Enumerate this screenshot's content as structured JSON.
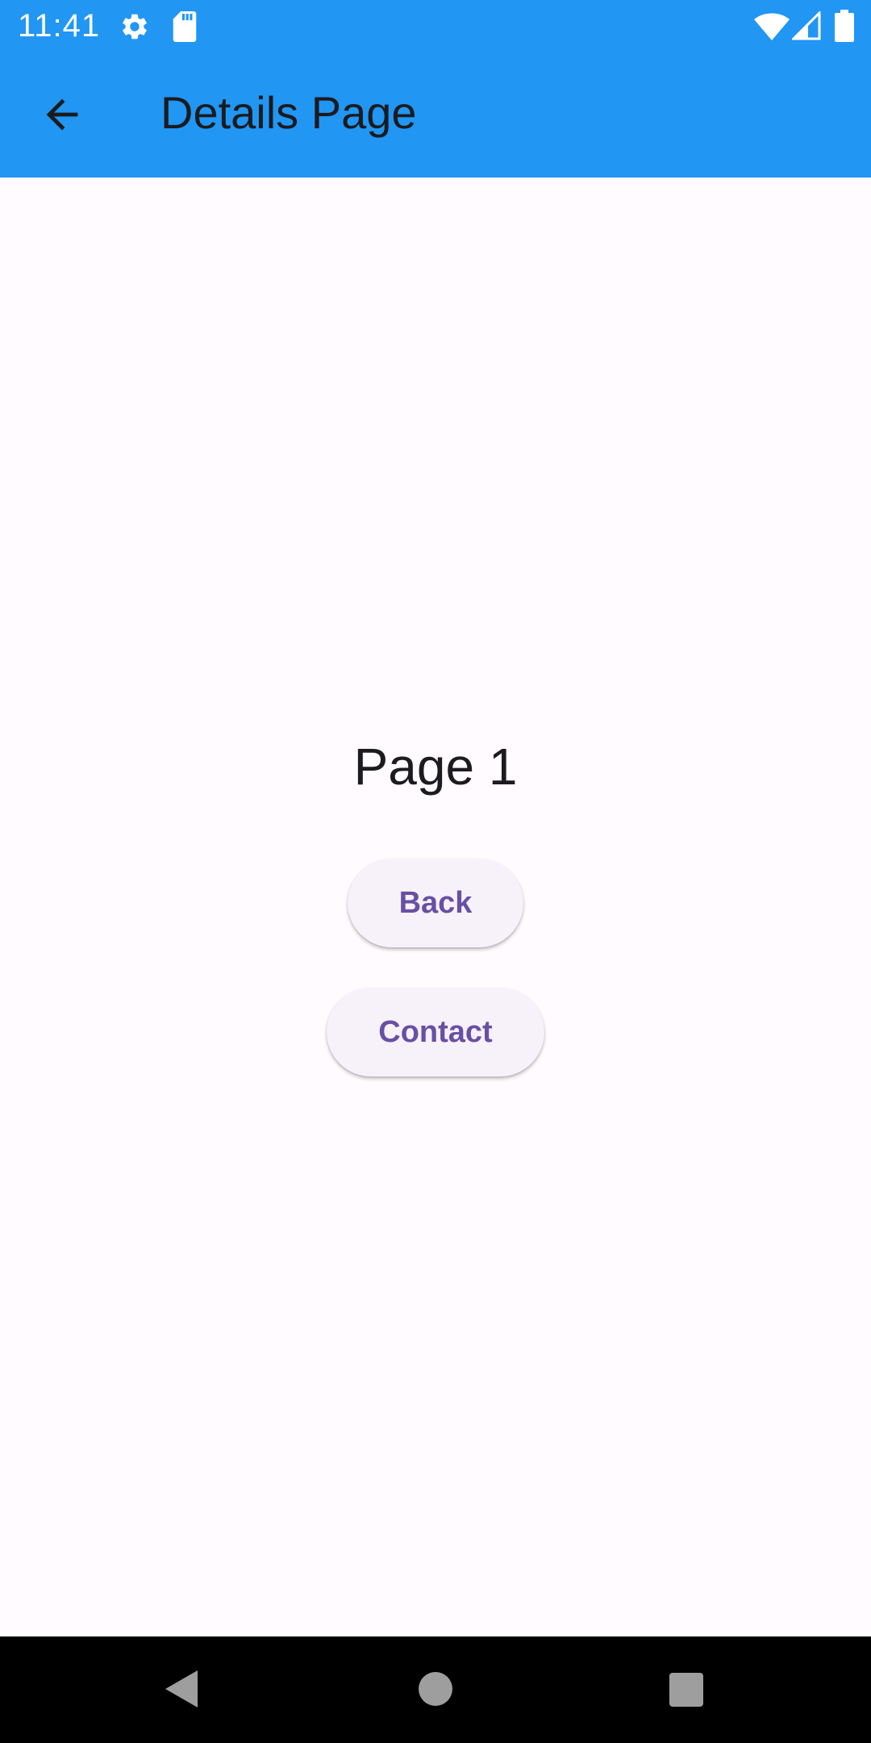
{
  "status_bar": {
    "time": "11:41",
    "background": "#2196f3",
    "icons": [
      "settings-icon",
      "sd-card-icon",
      "wifi-icon",
      "signal-icon",
      "battery-icon"
    ]
  },
  "app_bar": {
    "title": "Details Page",
    "background": "#2196f3",
    "leading_icon": "arrow-back-icon"
  },
  "main": {
    "heading": "Page 1",
    "buttons": [
      {
        "label": "Back"
      },
      {
        "label": "Contact"
      }
    ],
    "button_text_color": "#6750a4",
    "button_background": "#f7f2fa"
  },
  "nav_bar": {
    "icons": [
      "nav-back-icon",
      "nav-home-icon",
      "nav-recents-icon"
    ]
  }
}
